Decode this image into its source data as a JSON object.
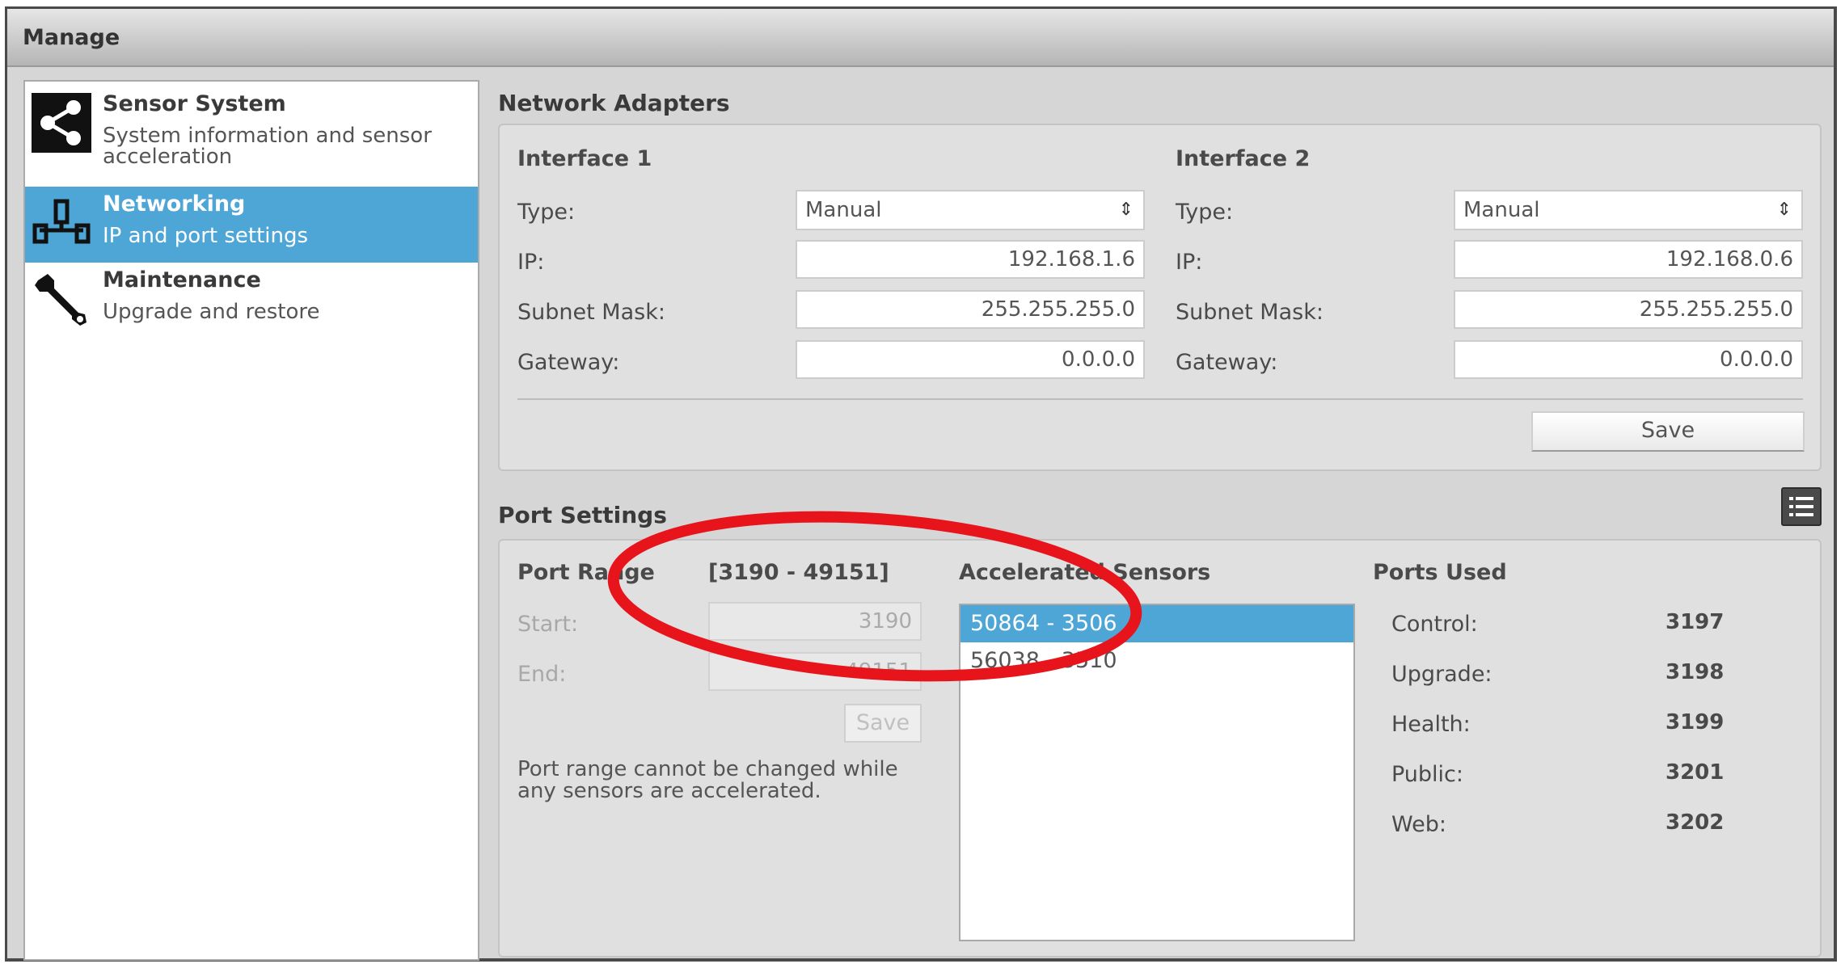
{
  "window": {
    "title": "Manage"
  },
  "sidebar": {
    "items": [
      {
        "title": "Sensor System",
        "description": "System information and sensor acceleration",
        "icon": "share-nodes-icon",
        "selected": false
      },
      {
        "title": "Networking",
        "description": "IP and port settings",
        "icon": "network-icon",
        "selected": true
      },
      {
        "title": "Maintenance",
        "description": "Upgrade and restore",
        "icon": "wrench-icon",
        "selected": false
      }
    ]
  },
  "network_adapters": {
    "section_title": "Network Adapters",
    "interfaces": [
      {
        "title": "Interface 1",
        "type_label": "Type:",
        "type_value": "Manual",
        "ip_label": "IP:",
        "ip_value": "192.168.1.6",
        "subnet_label": "Subnet Mask:",
        "subnet_value": "255.255.255.0",
        "gateway_label": "Gateway:",
        "gateway_value": "0.0.0.0"
      },
      {
        "title": "Interface 2",
        "type_label": "Type:",
        "type_value": "Manual",
        "ip_label": "IP:",
        "ip_value": "192.168.0.6",
        "subnet_label": "Subnet Mask:",
        "subnet_value": "255.255.255.0",
        "gateway_label": "Gateway:",
        "gateway_value": "0.0.0.0"
      }
    ],
    "save_label": "Save"
  },
  "port_settings": {
    "section_title": "Port Settings",
    "list_icon": "list-icon",
    "port_range_label": "Port Range",
    "port_range_value": "[3190 - 49151]",
    "start_label": "Start:",
    "start_value": "3190",
    "end_label": "End:",
    "end_value": "49151",
    "save_label": "Save",
    "note": "Port range cannot be changed while any sensors are accelerated.",
    "accelerated_title": "Accelerated Sensors",
    "accelerated_items": [
      "50864 - 3506",
      "56038 - 3510"
    ],
    "accelerated_selected": 0,
    "ports_used_title": "Ports Used",
    "ports_used": [
      {
        "label": "Control:",
        "value": "3197"
      },
      {
        "label": "Upgrade:",
        "value": "3198"
      },
      {
        "label": "Health:",
        "value": "3199"
      },
      {
        "label": "Public:",
        "value": "3201"
      },
      {
        "label": "Web:",
        "value": "3202"
      }
    ]
  },
  "annotation": {
    "color": "#e8141c"
  },
  "colors": {
    "selection": "#4ea6d7",
    "panel": "#e0e0e0",
    "window_bg": "#d6d6d6"
  }
}
